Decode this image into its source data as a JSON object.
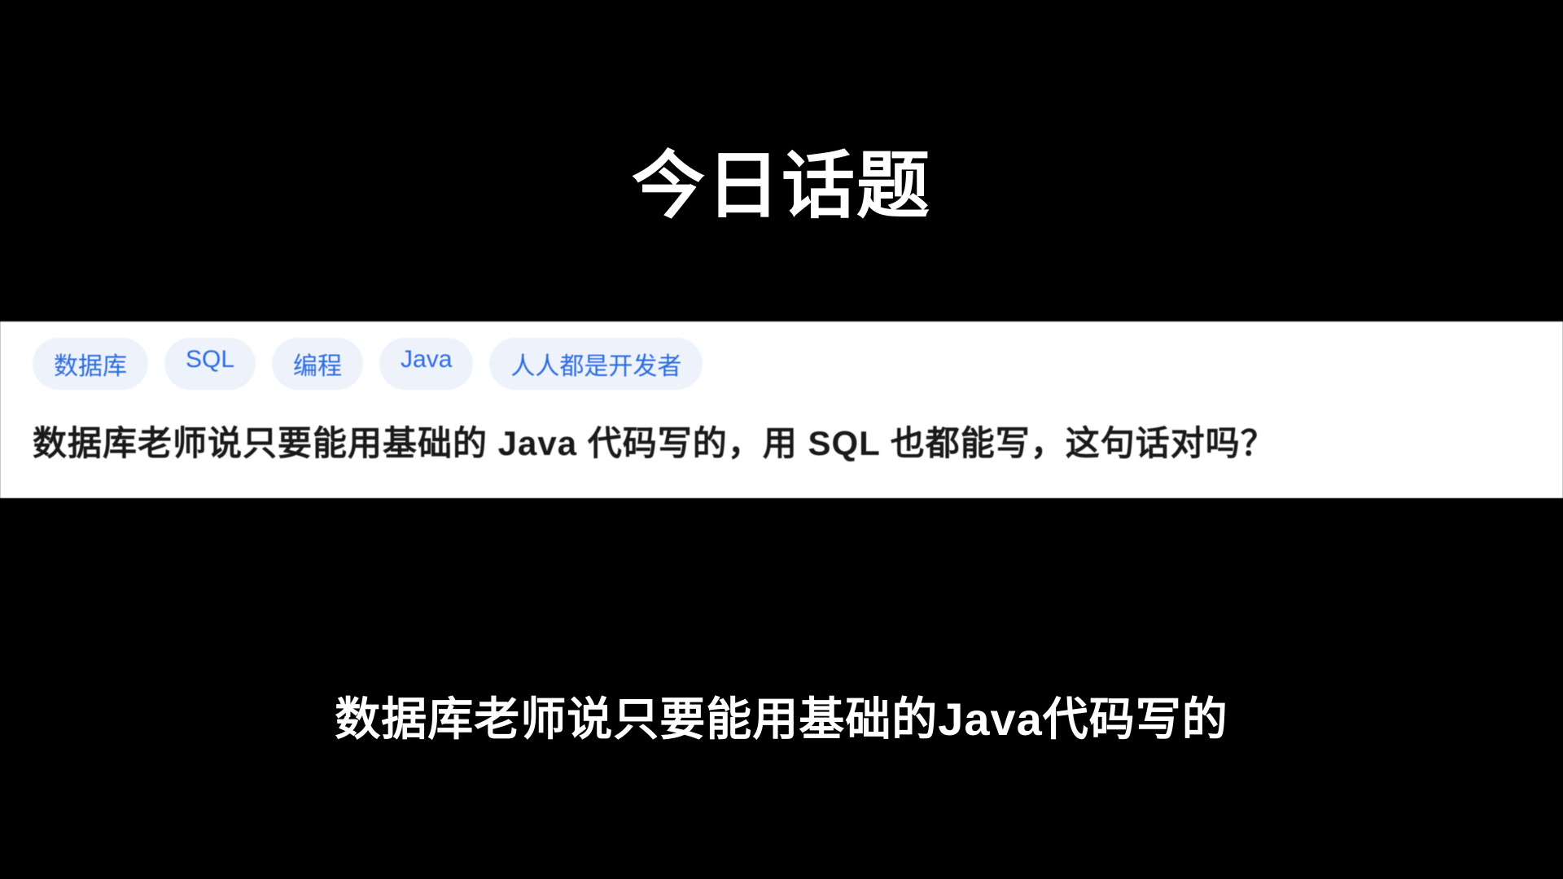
{
  "title": "今日话题",
  "card": {
    "tags": [
      "数据库",
      "SQL",
      "编程",
      "Java",
      "人人都是开发者"
    ],
    "question": "数据库老师说只要能用基础的 Java 代码写的，用 SQL 也都能写，这句话对吗？"
  },
  "subtitle": "数据库老师说只要能用基础的Java代码写的"
}
